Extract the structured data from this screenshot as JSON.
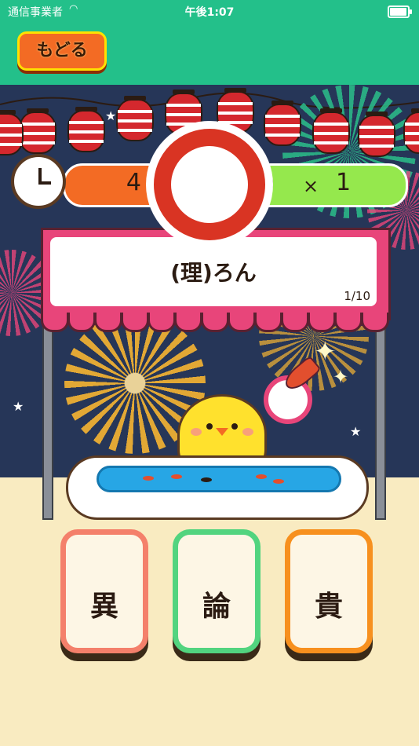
{
  "status_bar": {
    "carrier": "通信事業者",
    "time": "午後1:07",
    "battery_level": 0.95
  },
  "header": {
    "back_label": "もどる"
  },
  "hud": {
    "timer_value": "4",
    "score_prefix": "×",
    "score_value": "1",
    "timer_color": "#f36b24",
    "score_color": "#95e84d"
  },
  "question": {
    "text": "(理)ろん",
    "progress": "1/10",
    "result": "correct"
  },
  "answers": [
    {
      "label": "異",
      "color": "#f4806b"
    },
    {
      "label": "論",
      "color": "#52d47f"
    },
    {
      "label": "貴",
      "color": "#f7901e"
    }
  ],
  "colors": {
    "header_bg": "#23c08a",
    "sky": "#263658",
    "booth": "#e8457a",
    "ground": "#f9ebc1",
    "correct_mark": "#d93423"
  },
  "icons": {
    "timer": "clock-icon",
    "score": "poi-net-icon",
    "result": "correct-circle-icon"
  }
}
